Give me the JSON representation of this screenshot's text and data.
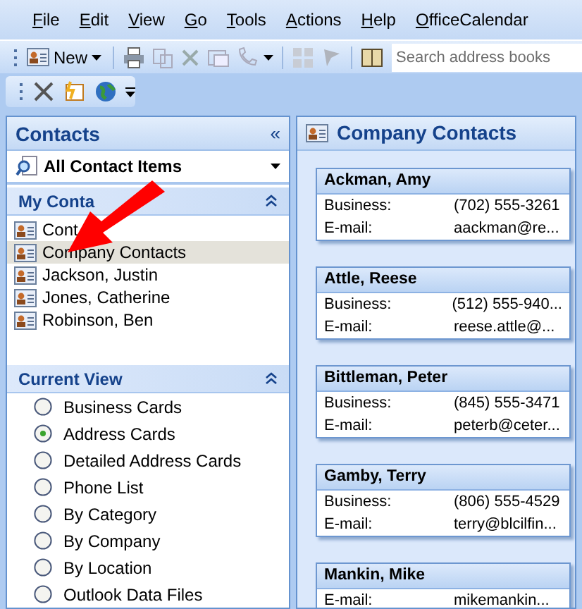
{
  "menu": [
    "File",
    "Edit",
    "View",
    "Go",
    "Tools",
    "Actions",
    "Help",
    "OfficeCalendar"
  ],
  "toolbar": {
    "new_label": "New",
    "search": {
      "placeholder": "Search address books"
    }
  },
  "navigation": {
    "title": "Contacts",
    "collapse_glyph": "«",
    "dropdown": "All Contact Items",
    "my_contacts": {
      "title": "My Conta",
      "expanded": true,
      "items": [
        {
          "label": "Cont",
          "selected": false
        },
        {
          "label": "Company Contacts",
          "selected": true
        },
        {
          "label": "Jackson, Justin",
          "selected": false
        },
        {
          "label": "Jones, Catherine",
          "selected": false
        },
        {
          "label": "Robinson, Ben",
          "selected": false
        }
      ]
    },
    "current_view": {
      "title": "Current View",
      "expanded": true,
      "options": [
        {
          "label": "Business Cards",
          "selected": false
        },
        {
          "label": "Address Cards",
          "selected": true
        },
        {
          "label": "Detailed Address Cards",
          "selected": false
        },
        {
          "label": "Phone List",
          "selected": false
        },
        {
          "label": "By Category",
          "selected": false
        },
        {
          "label": "By Company",
          "selected": false
        },
        {
          "label": "By Location",
          "selected": false
        },
        {
          "label": "Outlook Data Files",
          "selected": false
        }
      ]
    }
  },
  "content": {
    "title": "Company Contacts",
    "cards": [
      {
        "name": "Ackman, Amy",
        "fields": [
          {
            "label": "Business:",
            "value": "(702) 555-3261"
          },
          {
            "label": "E-mail:",
            "value": "aackman@re..."
          }
        ]
      },
      {
        "name": "Attle, Reese",
        "fields": [
          {
            "label": "Business:",
            "value": "(512) 555-940..."
          },
          {
            "label": "E-mail:",
            "value": "reese.attle@..."
          }
        ]
      },
      {
        "name": "Bittleman, Peter",
        "fields": [
          {
            "label": "Business:",
            "value": "(845) 555-3471"
          },
          {
            "label": "E-mail:",
            "value": "peterb@ceter..."
          }
        ]
      },
      {
        "name": "Gamby, Terry",
        "fields": [
          {
            "label": "Business:",
            "value": "(806) 555-4529"
          },
          {
            "label": "E-mail:",
            "value": "terry@blcilfin..."
          }
        ]
      },
      {
        "name": "Mankin, Mike",
        "fields": [
          {
            "label": "E-mail:",
            "value": "mikemankin..."
          }
        ]
      }
    ]
  }
}
